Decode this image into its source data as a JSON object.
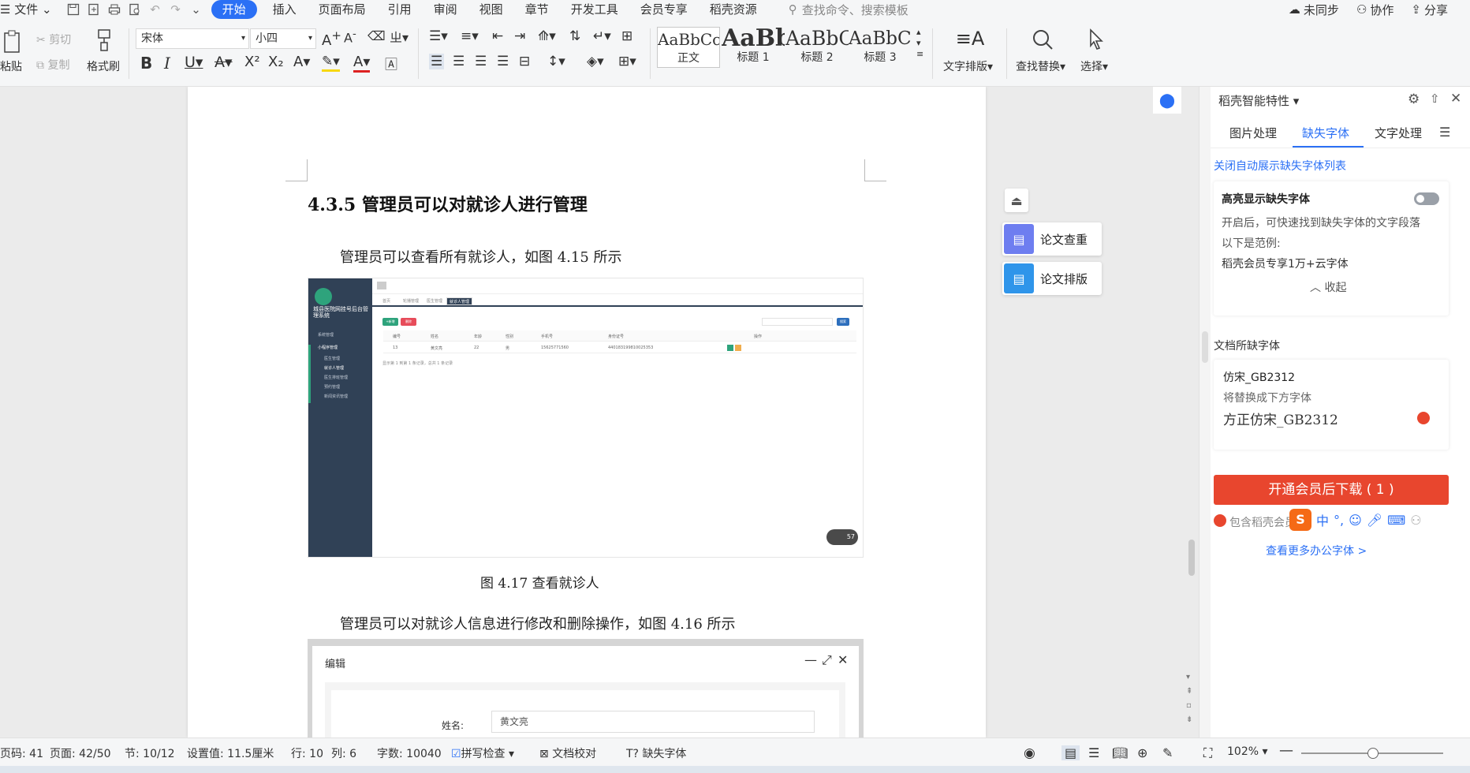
{
  "menubar": {
    "file": "文件",
    "tabs": [
      "开始",
      "插入",
      "页面布局",
      "引用",
      "审阅",
      "视图",
      "章节",
      "开发工具",
      "会员专享",
      "稻壳资源"
    ],
    "search_placeholder": "查找命令、搜索模板",
    "sync": "未同步",
    "collab": "协作",
    "share": "分享"
  },
  "ribbon": {
    "paste": "粘贴",
    "cut": "剪切",
    "copy": "复制",
    "format_painter": "格式刷",
    "font_name": "宋体",
    "font_size": "小四",
    "styles": [
      {
        "sample": "AaBbCcI",
        "label": "正文"
      },
      {
        "sample": "AaBb",
        "label": "标题 1"
      },
      {
        "sample": "AaBbC",
        "label": "标题 2"
      },
      {
        "sample": "AaBbCc",
        "label": "标题 3"
      }
    ],
    "text_layout": "文字排版",
    "find_replace": "查找替换",
    "select": "选择"
  },
  "document": {
    "heading": "4.3.5  管理员可以对就诊人进行管理",
    "para1": "管理员可以查看所有就诊人，如图 4.15 所示",
    "caption1": "图 4.17  查看就诊人",
    "para2": "管理员可以对就诊人信息进行修改和删除操作，如图 4.16 所示",
    "fig1": {
      "sidebar_title": "城县医院网挂号后台管理系统",
      "menu": [
        "系统管理",
        "小程序管理",
        "医生管理",
        "就诊人管理",
        "医生排班管理",
        "预约管理",
        "新闻资讯管理"
      ],
      "tabs": [
        "首页",
        "轮播管理",
        "医生管理",
        "就诊人管理"
      ],
      "btn_add": "+新增",
      "btn_del": "删除",
      "btn_search": "搜索",
      "columns": [
        "编号",
        "姓名",
        "年龄",
        "性别",
        "手机号",
        "身份证号",
        "操作"
      ],
      "row": [
        "13",
        "黄文亮",
        "22",
        "男",
        "15625771560",
        "440183199810025353"
      ],
      "footer": "显示第 1 到第 1 条记录，总共 1 条记录",
      "badge": "57"
    },
    "fig2": {
      "title": "编辑",
      "name_label": "姓名:",
      "name_value": "黄文亮"
    }
  },
  "float_buttons": [
    "论文查重",
    "论文排版"
  ],
  "panel": {
    "title": "稻壳智能特性",
    "tabs": [
      "图片处理",
      "缺失字体",
      "文字处理"
    ],
    "close_auto": "关闭自动展示缺失字体列表",
    "highlight_title": "高亮显示缺失字体",
    "highlight_desc": "开启后，可快速找到缺失字体的文字段落",
    "example_label": "以下是范例:",
    "example_text": "稻壳会员专享1万+云字体",
    "collapse": "收起",
    "missing_title": "文档所缺字体",
    "missing_font": "仿宋_GB2312",
    "replace_hint": "将替换成下方字体",
    "replace_font": "方正仿宋_GB2312",
    "download_btn": "开通会员后下载 ( 1 )",
    "include_text": "包含稻壳会员",
    "more_link": "查看更多办公字体 >",
    "ime": "中"
  },
  "statusbar": {
    "page_code": "页码: 41",
    "page": "页面: 42/50",
    "section": "节: 10/12",
    "setting": "设置值: 11.5厘米",
    "row": "行: 10",
    "col": "列: 6",
    "words": "字数: 10040",
    "spell": "拼写检查",
    "proof": "文档校对",
    "missing_font": "缺失字体",
    "zoom": "102%"
  }
}
